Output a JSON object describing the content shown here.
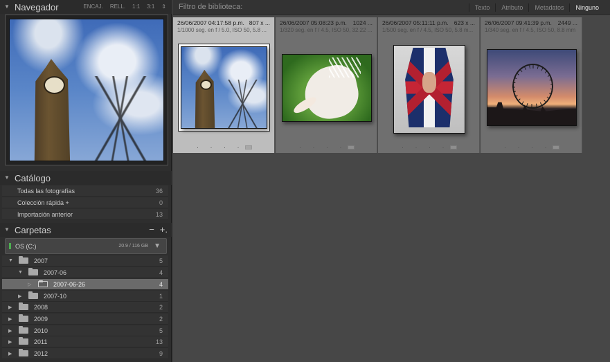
{
  "navigator": {
    "title": "Navegador",
    "zoom_options": [
      "ENCAJ.",
      "RELL.",
      "1:1",
      "3:1"
    ],
    "zoom_menu_icon": "up-down-arrows-icon"
  },
  "catalog": {
    "title": "Catálogo",
    "items": [
      {
        "label": "Todas las fotografías",
        "count": "36"
      },
      {
        "label": "Colección rápida  +",
        "count": "0"
      },
      {
        "label": "Importación anterior",
        "count": "13"
      }
    ]
  },
  "folders": {
    "title": "Carpetas",
    "remove_label": "−",
    "add_label": "+.",
    "volume": {
      "name": "OS (C:)",
      "size": "20.9 / 116 GB",
      "status_color": "#4caf50"
    },
    "tree": [
      {
        "name": "2007",
        "count": "5",
        "expanded": true,
        "level": 0
      },
      {
        "name": "2007-06",
        "count": "4",
        "expanded": true,
        "level": 1
      },
      {
        "name": "2007-06-26",
        "count": "4",
        "expanded": false,
        "level": 2,
        "selected": true
      },
      {
        "name": "2007-10",
        "count": "1",
        "expanded": false,
        "level": 1
      },
      {
        "name": "2008",
        "count": "2",
        "expanded": false,
        "level": 0
      },
      {
        "name": "2009",
        "count": "2",
        "expanded": false,
        "level": 0
      },
      {
        "name": "2010",
        "count": "5",
        "expanded": false,
        "level": 0
      },
      {
        "name": "2011",
        "count": "13",
        "expanded": false,
        "level": 0
      },
      {
        "name": "2012",
        "count": "9",
        "expanded": false,
        "level": 0
      }
    ]
  },
  "library_filter": {
    "title": "Filtro de biblioteca:",
    "tabs": [
      "Texto",
      "Atributo",
      "Metadatos",
      "Ninguno"
    ],
    "active_tab": "Ninguno"
  },
  "grid": {
    "photos": [
      {
        "datetime": "26/06/2007 04:17:58 p.m.",
        "dims": "807 x ...",
        "exposure": "1/1000 seg. en f / 5.0, ISO 50, 5.8 ...",
        "selected": true,
        "art": "bigben"
      },
      {
        "datetime": "26/06/2007 05:08:23 p.m.",
        "dims": "1024 ...",
        "exposure": "1/320 seg. en f / 4.5, ISO 50, 32.22 ...",
        "selected": false,
        "art": "pelican"
      },
      {
        "datetime": "26/06/2007 05:11:11 p.m.",
        "dims": "623 x ...",
        "exposure": "1/500 seg. en f / 4.5, ISO 50, 5.8 m...",
        "selected": false,
        "art": "flag"
      },
      {
        "datetime": "26/06/2007 09:41:39 p.m.",
        "dims": "2449 ...",
        "exposure": "1/340 seg. en f / 4.5, ISO 50, 8.8 mm",
        "selected": false,
        "art": "eye"
      }
    ],
    "rating_dots": "· · · · ·"
  },
  "colors": {
    "panel_bg": "#2e2e2e",
    "grid_bg": "#474747",
    "cell_bg": "#6f6f6f",
    "cell_selected_bg": "#bdbdbd",
    "folder_selected_bg": "#6a6a6a"
  }
}
